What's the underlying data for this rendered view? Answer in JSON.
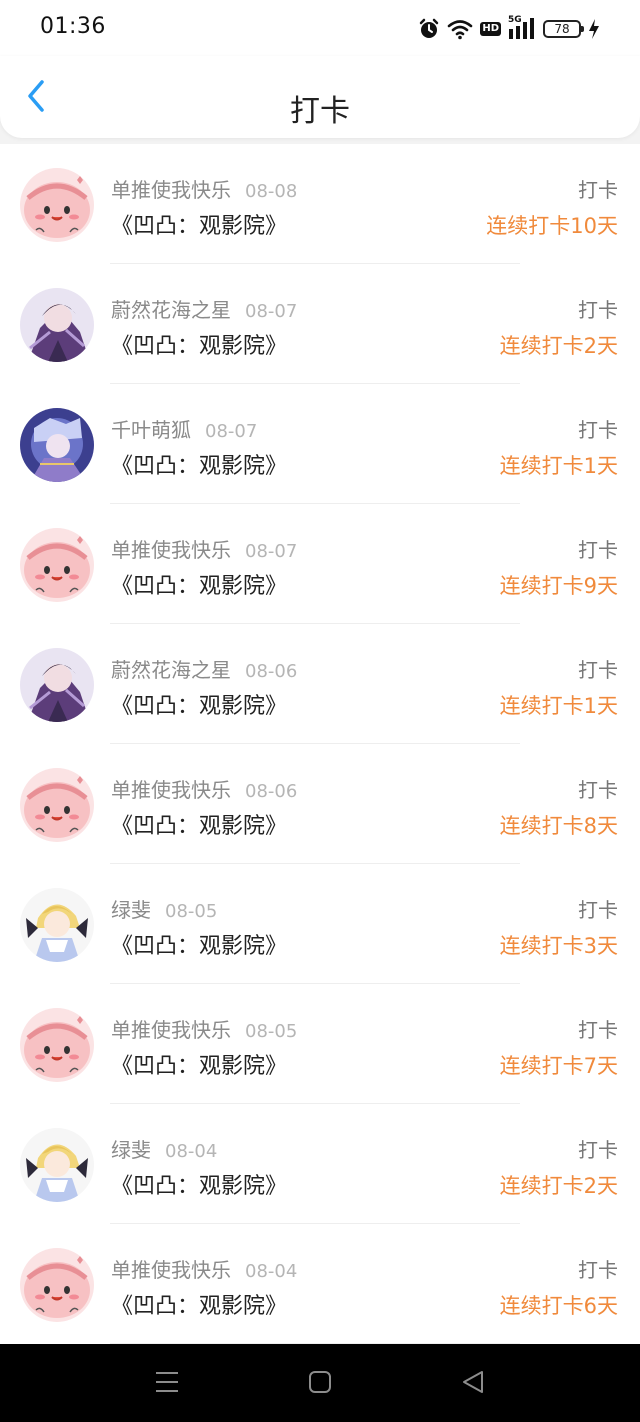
{
  "status_bar": {
    "time": "01:36",
    "network": "5G",
    "hd": "HD",
    "battery": "78",
    "icons": [
      "alarm-icon",
      "wifi-icon",
      "hd-icon",
      "cellular-5g-icon",
      "battery-icon",
      "charging-icon"
    ]
  },
  "nav": {
    "title": "打卡",
    "back_icon": "chevron-left-icon",
    "back_color": "#2a9df4"
  },
  "colors": {
    "streak": "#f08a3c",
    "username": "#8a8a8a",
    "date": "#b5b5b5"
  },
  "checkins": [
    {
      "user": "单推使我快乐",
      "date": "08-08",
      "topic": "《凹凸：观影院》",
      "action": "打卡",
      "streak": "连续打卡10天",
      "avatar": "pink-blob-avatar"
    },
    {
      "user": "蔚然花海之星",
      "date": "08-07",
      "topic": "《凹凸：观影院》",
      "action": "打卡",
      "streak": "连续打卡2天",
      "avatar": "purple-anime-avatar"
    },
    {
      "user": "千叶萌狐",
      "date": "08-07",
      "topic": "《凹凸：观影院》",
      "action": "打卡",
      "streak": "连续打卡1天",
      "avatar": "blue-anime-avatar"
    },
    {
      "user": "单推使我快乐",
      "date": "08-07",
      "topic": "《凹凸：观影院》",
      "action": "打卡",
      "streak": "连续打卡9天",
      "avatar": "pink-blob-avatar"
    },
    {
      "user": "蔚然花海之星",
      "date": "08-06",
      "topic": "《凹凸：观影院》",
      "action": "打卡",
      "streak": "连续打卡1天",
      "avatar": "purple-anime-avatar"
    },
    {
      "user": "单推使我快乐",
      "date": "08-06",
      "topic": "《凹凸：观影院》",
      "action": "打卡",
      "streak": "连续打卡8天",
      "avatar": "pink-blob-avatar"
    },
    {
      "user": "绿斐",
      "date": "08-05",
      "topic": "《凹凸：观影院》",
      "action": "打卡",
      "streak": "连续打卡3天",
      "avatar": "blonde-anime-avatar"
    },
    {
      "user": "单推使我快乐",
      "date": "08-05",
      "topic": "《凹凸：观影院》",
      "action": "打卡",
      "streak": "连续打卡7天",
      "avatar": "pink-blob-avatar"
    },
    {
      "user": "绿斐",
      "date": "08-04",
      "topic": "《凹凸：观影院》",
      "action": "打卡",
      "streak": "连续打卡2天",
      "avatar": "blonde-anime-avatar"
    },
    {
      "user": "单推使我快乐",
      "date": "08-04",
      "topic": "《凹凸：观影院》",
      "action": "打卡",
      "streak": "连续打卡6天",
      "avatar": "pink-blob-avatar"
    }
  ],
  "system_nav": {
    "icons": [
      "menu-icon",
      "home-icon",
      "back-icon"
    ]
  }
}
